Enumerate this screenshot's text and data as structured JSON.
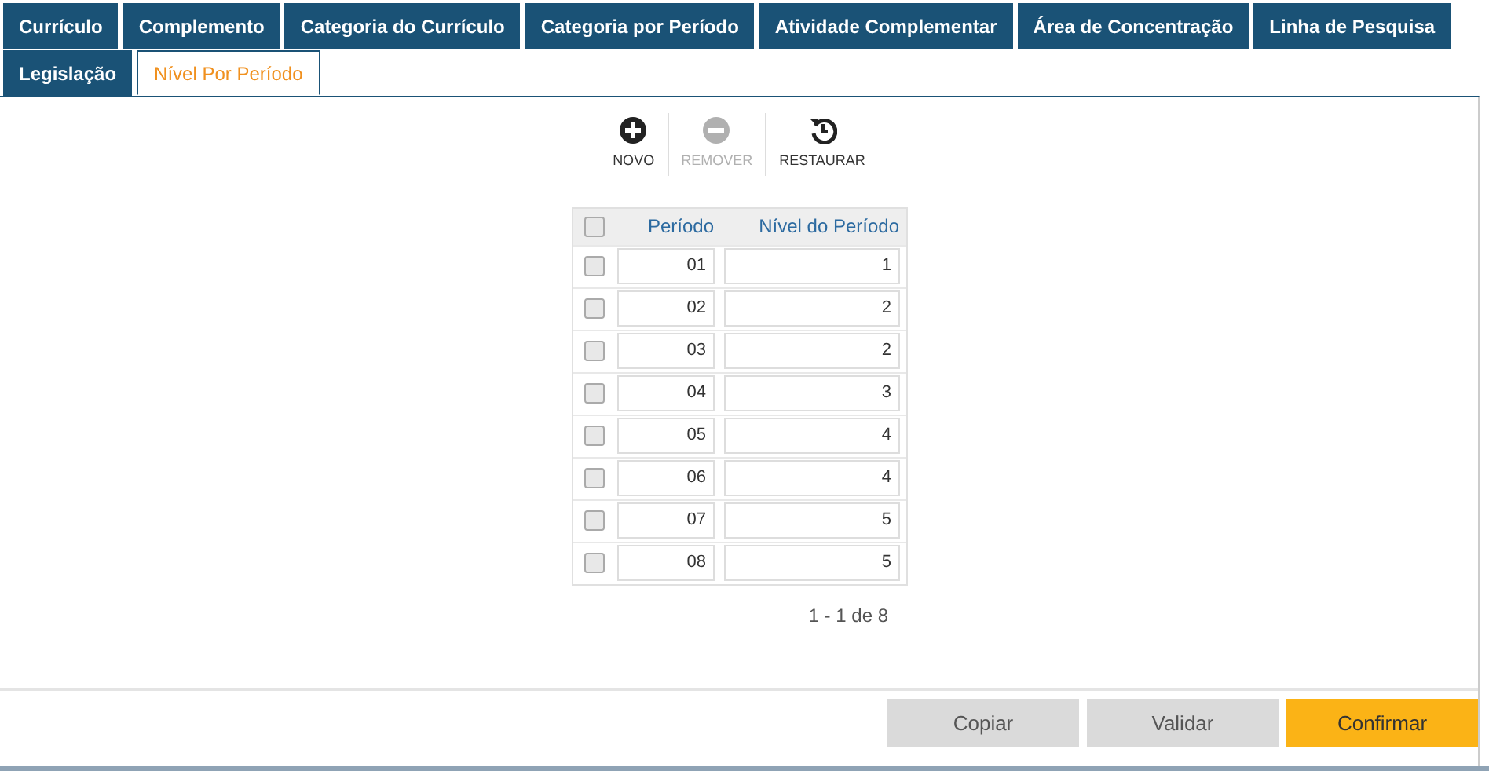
{
  "tabs": [
    {
      "label": "Currículo",
      "selected": false
    },
    {
      "label": "Complemento",
      "selected": false
    },
    {
      "label": "Categoria do Currículo",
      "selected": false
    },
    {
      "label": "Categoria por Período",
      "selected": false
    },
    {
      "label": "Atividade Complementar",
      "selected": false
    },
    {
      "label": "Área de Concentração",
      "selected": false
    },
    {
      "label": "Linha de Pesquisa",
      "selected": false
    },
    {
      "label": "Legislação",
      "selected": false
    },
    {
      "label": "Nível Por Período",
      "selected": true
    }
  ],
  "toolbar": [
    {
      "kind": "add",
      "label": "NOVO",
      "disabled": false
    },
    {
      "kind": "remove",
      "label": "REMOVER",
      "disabled": true
    },
    {
      "kind": "restore",
      "label": "RESTAURAR",
      "disabled": false
    }
  ],
  "table": {
    "select_all": {
      "checked": false
    },
    "columns": [
      "Período",
      "Nível do Período"
    ],
    "rows": [
      {
        "checked": false,
        "periodo": "01",
        "nivel": "1"
      },
      {
        "checked": false,
        "periodo": "02",
        "nivel": "2"
      },
      {
        "checked": false,
        "periodo": "03",
        "nivel": "2"
      },
      {
        "checked": false,
        "periodo": "04",
        "nivel": "3"
      },
      {
        "checked": false,
        "periodo": "05",
        "nivel": "4"
      },
      {
        "checked": false,
        "periodo": "06",
        "nivel": "4"
      },
      {
        "checked": false,
        "periodo": "07",
        "nivel": "5"
      },
      {
        "checked": false,
        "periodo": "08",
        "nivel": "5"
      }
    ],
    "pagination": "1 - 1 de 8"
  },
  "buttons": [
    {
      "label": "Copiar",
      "kind": "secondary"
    },
    {
      "label": "Validar",
      "kind": "secondary"
    },
    {
      "label": "Confirmar",
      "kind": "primary"
    }
  ]
}
